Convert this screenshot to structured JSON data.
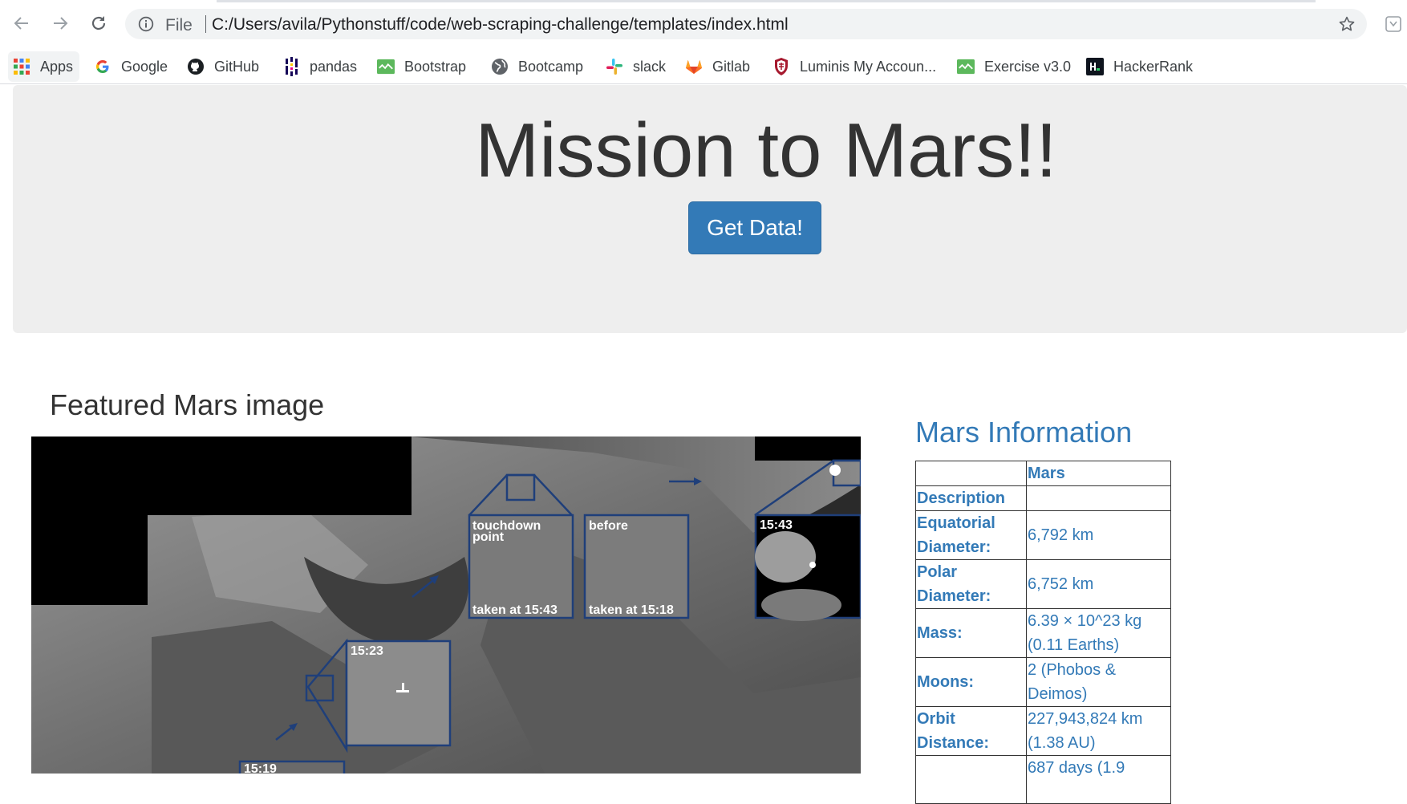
{
  "browser": {
    "file_label": "File",
    "url": "C:/Users/avila/Pythonstuff/code/web-scraping-challenge/templates/index.html"
  },
  "bookmarks": [
    {
      "label": "Apps",
      "icon": "apps-grid-icon"
    },
    {
      "label": "Google",
      "icon": "google-icon"
    },
    {
      "label": "GitHub",
      "icon": "github-icon"
    },
    {
      "label": "pandas",
      "icon": "pandas-icon"
    },
    {
      "label": "Bootstrap",
      "icon": "bootstrap-icon"
    },
    {
      "label": "Bootcamp",
      "icon": "globe-icon"
    },
    {
      "label": "slack",
      "icon": "slack-icon"
    },
    {
      "label": "Gitlab",
      "icon": "gitlab-icon"
    },
    {
      "label": "Luminis My Accoun...",
      "icon": "luminis-shield-icon"
    },
    {
      "label": "Exercise v3.0",
      "icon": "exercise-icon"
    },
    {
      "label": "HackerRank",
      "icon": "hackerrank-icon"
    }
  ],
  "page": {
    "title": "Mission to Mars!!",
    "button_label": "Get Data!",
    "featured_title": "Featured Mars image",
    "image_labels": {
      "touchdown": [
        "touchdown",
        "point"
      ],
      "taken_1543": "taken at 15:43",
      "before": "before",
      "taken_1518": "taken at 15:18",
      "t1543": "15:43",
      "t1523": "15:23",
      "t1519": "15:19"
    },
    "info_title": "Mars Information",
    "facts_header": "Mars",
    "facts": [
      {
        "key": "Description",
        "value": ""
      },
      {
        "key": "Equatorial Diameter:",
        "value": "6,792 km"
      },
      {
        "key": "Polar Diameter:",
        "value": "6,752 km"
      },
      {
        "key": "Mass:",
        "value": "6.39 × 10^23 kg (0.11 Earths)"
      },
      {
        "key": "Moons:",
        "value": "2 (Phobos & Deimos)"
      },
      {
        "key": "Orbit Distance:",
        "value": "227,943,824 km (1.38 AU)"
      },
      {
        "key": "",
        "value": "687 days (1.9"
      }
    ]
  },
  "colors": {
    "primary": "#337ab7",
    "jumbotron": "#eeeeee",
    "text": "#333333"
  }
}
